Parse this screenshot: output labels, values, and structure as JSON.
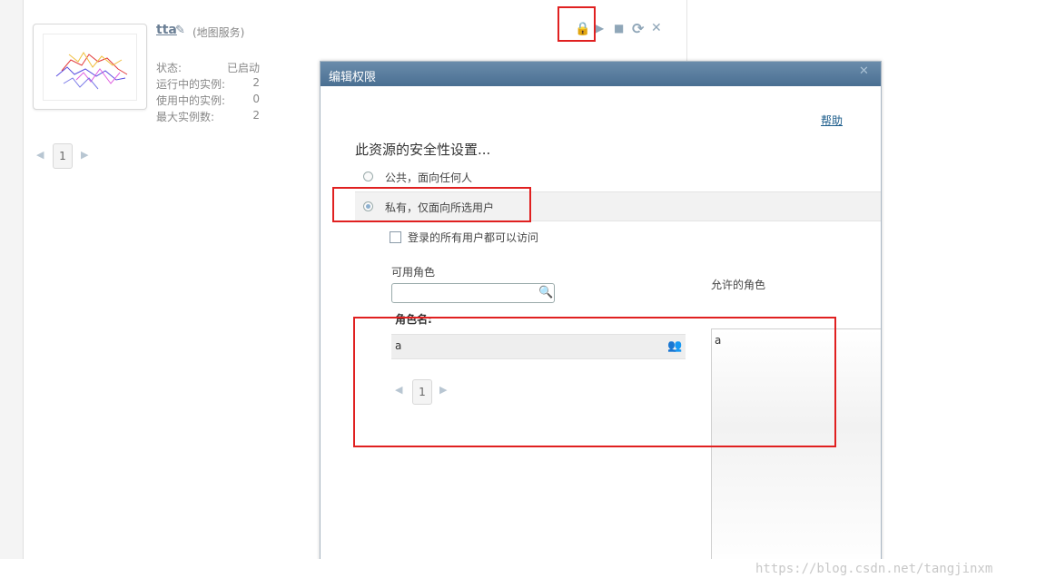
{
  "service": {
    "name": "tta",
    "type": "(地图服务)",
    "stats": [
      {
        "label": "状态:",
        "value": "已启动"
      },
      {
        "label": "运行中的实例:",
        "value": "2"
      },
      {
        "label": "使用中的实例:",
        "value": "0"
      },
      {
        "label": "最大实例数:",
        "value": "2"
      }
    ]
  },
  "toolbar": {
    "lock_icon": "🔒",
    "start_icon": "▶",
    "stop_icon": "■",
    "refresh_icon": "⟳",
    "delete_icon": "✕"
  },
  "pager": {
    "prev": "◀",
    "page": "1",
    "next": "▶"
  },
  "dialog": {
    "title": "编辑权限",
    "close": "✕",
    "help": "帮助",
    "heading": "此资源的安全性设置...",
    "option_public": "公共，面向任何人",
    "option_private": "私有，仅面向所选用户",
    "selected_option": "private",
    "logged_in_checkbox": "登录的所有用户都可以访问",
    "available_roles_label": "可用角色",
    "allowed_roles_label": "允许的角色",
    "role_name_header": "角色名:",
    "available_roles": [
      "a"
    ],
    "allowed_roles": [
      "a"
    ],
    "search_icon": "🔍",
    "add_icon": "👥",
    "pager": {
      "prev": "◀",
      "page": "1",
      "next": "▶"
    }
  },
  "watermark": "https://blog.csdn.net/tangjinxm",
  "colors": {
    "highlight": "#e02020",
    "title_bar": "#4a6f92",
    "link": "#1a5b8a"
  }
}
